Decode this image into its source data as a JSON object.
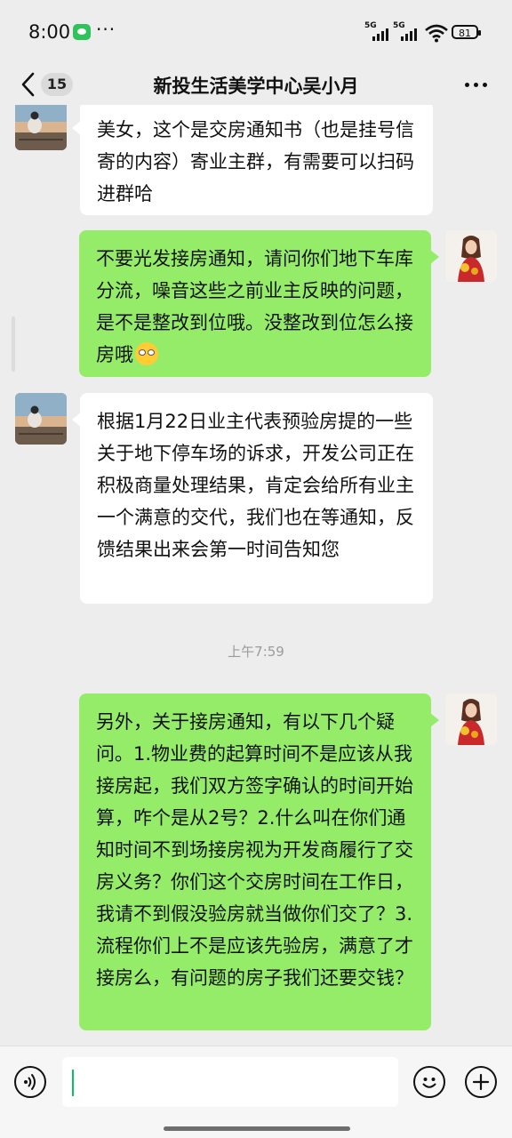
{
  "status_bar": {
    "time": "8:00",
    "notification_more": "···",
    "sim1_label": "5G",
    "sim2_label": "5G",
    "battery_level": "81"
  },
  "header": {
    "unread_count": "15",
    "title": "新投生活美学中心吴小月"
  },
  "messages": [
    {
      "side": "left",
      "text": "美女，这个是交房通知书（也是挂号信寄的内容）寄业主群，有需要可以扫码进群哈"
    },
    {
      "side": "right",
      "text": "不要光发接房通知，请问你们地下车库分流，噪音这些之前业主反映的问题，是不是整改到位哦。没整改到位怎么接房哦",
      "emoji": "eye-roll-emoji"
    },
    {
      "side": "left",
      "text": "根据1月22日业主代表预验房提的一些关于地下停车场的诉求，开发公司正在积极商量处理结果，肯定会给所有业主一个满意的交代，我们也在等通知，反馈结果出来会第一时间告知您"
    },
    {
      "side": "right",
      "text": "另外，关于接房通知，有以下几个疑问。1.物业费的起算时间不是应该从我接房起，我们双方签字确认的时间开始算，咋个是从2号？2.什么叫在你们通知时间不到场接房视为开发商履行了交房义务？你们这个交房时间在工作日，我请不到假没验房就当做你们交了？3.流程你们上不是应该先验房，满意了才接房么，有问题的房子我们还要交钱？"
    }
  ],
  "timestamp": "上午7:59",
  "input_bar": {
    "input_value": "",
    "icons": [
      "voice-icon",
      "emoji-icon",
      "plus-icon"
    ]
  },
  "colors": {
    "outgoing_bubble": "#95ec69",
    "incoming_bubble": "#ffffff",
    "background": "#ededed",
    "caret": "#07c160"
  }
}
